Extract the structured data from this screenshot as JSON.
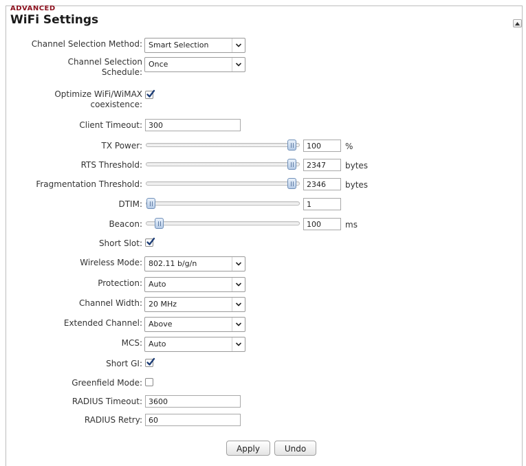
{
  "header": {
    "section_label": "ADVANCED",
    "title": "WiFi Settings"
  },
  "fields": {
    "channel_selection_method": {
      "label": "Channel Selection Method:",
      "value": "Smart Selection"
    },
    "channel_selection_schedule": {
      "label_line1": "Channel Selection",
      "label_line2": "Schedule:",
      "value": "Once"
    },
    "optimize_coexistence": {
      "label_line1": "Optimize WiFi/WiMAX",
      "label_line2": "coexistence:",
      "checked": true
    },
    "client_timeout": {
      "label": "Client Timeout:",
      "value": "300"
    },
    "tx_power": {
      "label": "TX Power:",
      "value": "100",
      "unit": "%",
      "slider_fraction": 1.0
    },
    "rts_threshold": {
      "label": "RTS Threshold:",
      "value": "2347",
      "unit": "bytes",
      "slider_fraction": 1.0
    },
    "fragmentation_threshold": {
      "label": "Fragmentation Threshold:",
      "value": "2346",
      "unit": "bytes",
      "slider_fraction": 1.0
    },
    "dtim": {
      "label": "DTIM:",
      "value": "1",
      "unit": "",
      "slider_fraction": 0.0
    },
    "beacon": {
      "label": "Beacon:",
      "value": "100",
      "unit": "ms",
      "slider_fraction": 0.06
    },
    "short_slot": {
      "label": "Short Slot:",
      "checked": true
    },
    "wireless_mode": {
      "label": "Wireless Mode:",
      "value": "802.11 b/g/n"
    },
    "protection": {
      "label": "Protection:",
      "value": "Auto"
    },
    "channel_width": {
      "label": "Channel Width:",
      "value": "20 MHz"
    },
    "extended_channel": {
      "label": "Extended Channel:",
      "value": "Above"
    },
    "mcs": {
      "label": "MCS:",
      "value": "Auto"
    },
    "short_gi": {
      "label": "Short GI:",
      "checked": true
    },
    "greenfield_mode": {
      "label": "Greenfield Mode:",
      "checked": false
    },
    "radius_timeout": {
      "label": "RADIUS Timeout:",
      "value": "3600"
    },
    "radius_retry": {
      "label": "RADIUS Retry:",
      "value": "60"
    }
  },
  "buttons": {
    "apply": "Apply",
    "undo": "Undo"
  },
  "icons": {
    "collapse": "collapse-up-icon",
    "dropdown": "chevron-down-icon",
    "checkmark": "checkmark-icon",
    "slider_thumb": "slider-thumb-icon"
  },
  "colors": {
    "section_label": "#8b0f1c",
    "checkmark": "#1f3f77",
    "slider_thumb": "#b6cbe6"
  }
}
